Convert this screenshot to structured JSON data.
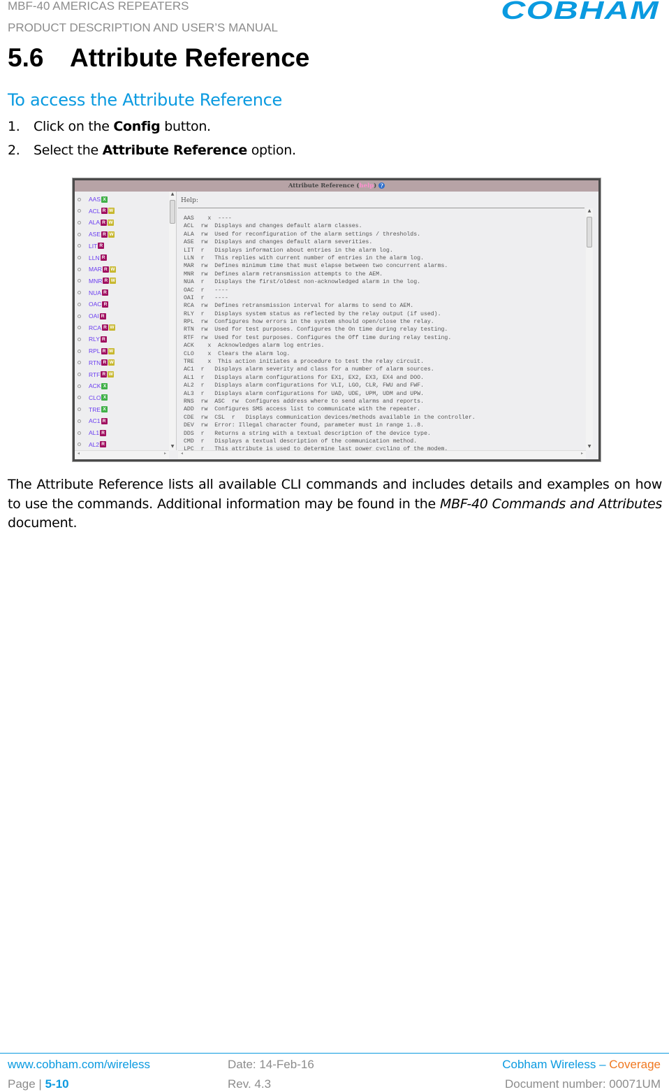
{
  "header": {
    "line1": "MBF-40 AMERICAS REPEATERS",
    "line2": "PRODUCT DESCRIPTION AND USER’S MANUAL",
    "logo": "COBHAM"
  },
  "section": {
    "number": "5.6",
    "title": "Attribute Reference"
  },
  "subheading": "To access the Attribute Reference",
  "steps": [
    {
      "n": "1.",
      "pre": "Click on the ",
      "bold": "Config",
      "post": " button."
    },
    {
      "n": "2.",
      "pre": "Select the ",
      "bold": "Attribute Reference",
      "post": " option."
    }
  ],
  "screenshot": {
    "title": "Attribute Reference (",
    "help_link": "help",
    "title_end": ")",
    "help_icon": "question-icon",
    "help_label": "Help:",
    "badge_colors": {
      "R": "#a01060",
      "W": "#c8b830",
      "X": "#40b048"
    },
    "attributes": [
      {
        "code": "AAS",
        "badges": [
          "X"
        ]
      },
      {
        "code": "ACL",
        "badges": [
          "R",
          "W"
        ]
      },
      {
        "code": "ALA",
        "badges": [
          "R",
          "W"
        ]
      },
      {
        "code": "ASE",
        "badges": [
          "R",
          "W"
        ]
      },
      {
        "code": "LIT",
        "badges": [
          "R"
        ]
      },
      {
        "code": "LLN",
        "badges": [
          "R"
        ]
      },
      {
        "code": "MAR",
        "badges": [
          "R",
          "W"
        ]
      },
      {
        "code": "MNR",
        "badges": [
          "R",
          "W"
        ]
      },
      {
        "code": "NUA",
        "badges": [
          "R"
        ]
      },
      {
        "code": "OAC",
        "badges": [
          "R"
        ]
      },
      {
        "code": "OAI",
        "badges": [
          "R"
        ]
      },
      {
        "code": "RCA",
        "badges": [
          "R",
          "W"
        ]
      },
      {
        "code": "RLY",
        "badges": [
          "R"
        ]
      },
      {
        "code": "RPL",
        "badges": [
          "R",
          "W"
        ]
      },
      {
        "code": "RTN",
        "badges": [
          "R",
          "W"
        ]
      },
      {
        "code": "RTF",
        "badges": [
          "R",
          "W"
        ]
      },
      {
        "code": "ACK",
        "badges": [
          "X"
        ]
      },
      {
        "code": "CLO",
        "badges": [
          "X"
        ]
      },
      {
        "code": "TRE",
        "badges": [
          "X"
        ]
      },
      {
        "code": "AC1",
        "badges": [
          "R"
        ]
      },
      {
        "code": "AL1",
        "badges": [
          "R"
        ]
      },
      {
        "code": "AL2",
        "badges": [
          "R"
        ]
      }
    ],
    "help_lines": [
      [
        "AAS",
        "  x",
        "----"
      ],
      [
        "ACL",
        "rw",
        "Displays and changes default alarm classes."
      ],
      [
        "ALA",
        "rw",
        "Used for reconfiguration of the alarm settings / thresholds."
      ],
      [
        "ASE",
        "rw",
        "Displays and changes default alarm severities."
      ],
      [
        "LIT",
        "r ",
        "Displays information about entries in the alarm log."
      ],
      [
        "LLN",
        "r ",
        "This replies with current number of entries in the alarm log."
      ],
      [
        "MAR",
        "rw",
        "Defines minimum time that must elapse between two concurrent alarms."
      ],
      [
        "MNR",
        "rw",
        "Defines alarm retransmission attempts to the AEM."
      ],
      [
        "NUA",
        "r ",
        "Displays the first/oldest non-acknowledged alarm in the log."
      ],
      [
        "OAC",
        "r ",
        "----"
      ],
      [
        "OAI",
        "r ",
        "----"
      ],
      [
        "RCA",
        "rw",
        "Defines retransmission interval for alarms to send to AEM."
      ],
      [
        "RLY",
        "r ",
        "Displays system status as reflected by the relay output (if used)."
      ],
      [
        "RPL",
        "rw",
        "Configures how errors in the system should open/close the relay."
      ],
      [
        "RTN",
        "rw",
        "Used for test purposes. Configures the On time during relay testing."
      ],
      [
        "RTF",
        "rw",
        "Used for test purposes. Configures the Off time during relay testing."
      ],
      [
        "ACK",
        "  x",
        "Acknowledges alarm log entries."
      ],
      [
        "CLO",
        "  x",
        "Clears the alarm log."
      ],
      [
        "TRE",
        "  x",
        "This action initiates a procedure to test the relay circuit."
      ],
      [
        "AC1",
        "r ",
        "Displays alarm severity and class for a number of alarm sources."
      ],
      [
        "AL1",
        "r ",
        "Displays alarm configurations for EX1, EX2, EX3, EX4 and DOO."
      ],
      [
        "AL2",
        "r ",
        "Displays alarm configurations for VLI, LGO, CLR, FWU and FWF."
      ],
      [
        "AL3",
        "r ",
        "Displays alarm configurations for UAD, UDE, UPM, UDM and UPW."
      ],
      [
        "RNS",
        "rw",
        "ASC  rw  Configures address where to send alarms and reports."
      ],
      [
        "ADD",
        "rw",
        "Configures SMS access list to communicate with the repeater."
      ],
      [
        "CDE",
        "rw",
        "CSL  r   Displays communication devices/methods available in the controller."
      ],
      [
        "DEV",
        "rw",
        "Error: Illegal character found, parameter must in range 1..8."
      ],
      [
        "DDS",
        "r ",
        "Returns a string with a textual description of the device type."
      ],
      [
        "CMD",
        "r ",
        "Displays a textual description of the communication method."
      ],
      [
        "LPC",
        "r ",
        "This attribute is used to determine last power cycling of the modem."
      ]
    ]
  },
  "paragraph": {
    "text1": "The Attribute Reference lists all available CLI commands and includes details and examples on how to use the commands. Additional information may be found in the ",
    "italic": "MBF-40 Commands and Attributes",
    "text2": " document."
  },
  "footer": {
    "url": "www.cobham.com/wireless",
    "page_label": "Page | ",
    "page": "5-10",
    "date": "Date: 14-Feb-16",
    "rev": "Rev. 4.3",
    "company": "Cobham Wireless – ",
    "coverage": "Coverage",
    "docnum": "Document number: 00071UM"
  },
  "colors": {
    "accent": "#0a9ae0",
    "coverage": "#f07820"
  }
}
